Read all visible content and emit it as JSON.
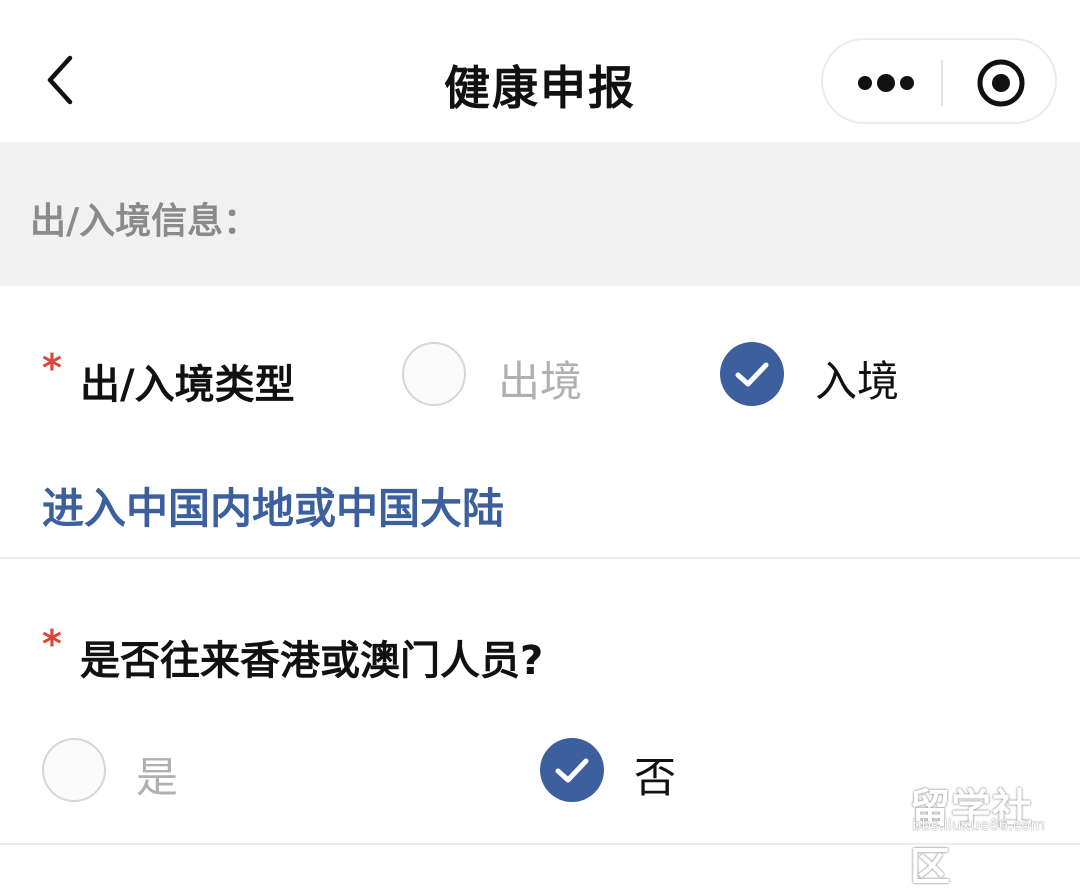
{
  "header": {
    "title": "健康申报"
  },
  "section": {
    "title": "出/入境信息："
  },
  "question1": {
    "required_mark": "*",
    "label": "出/入境类型",
    "options": [
      {
        "label": "出境",
        "selected": false
      },
      {
        "label": "入境",
        "selected": true
      }
    ],
    "detail": "进入中国内地或中国大陆"
  },
  "question2": {
    "required_mark": "*",
    "label": "是否往来香港或澳门人员?",
    "options": [
      {
        "label": "是",
        "selected": false
      },
      {
        "label": "否",
        "selected": true
      }
    ]
  },
  "watermark": {
    "main": "留学社区",
    "sub": "bbs.liuxue86.com"
  },
  "colors": {
    "accent": "#3d5f9e",
    "required": "#d9463b",
    "section_bg": "#f1f1f1"
  },
  "icons": {
    "back": "chevron-left-icon",
    "more": "more-dots-icon",
    "close": "target-icon",
    "check": "check-icon"
  }
}
